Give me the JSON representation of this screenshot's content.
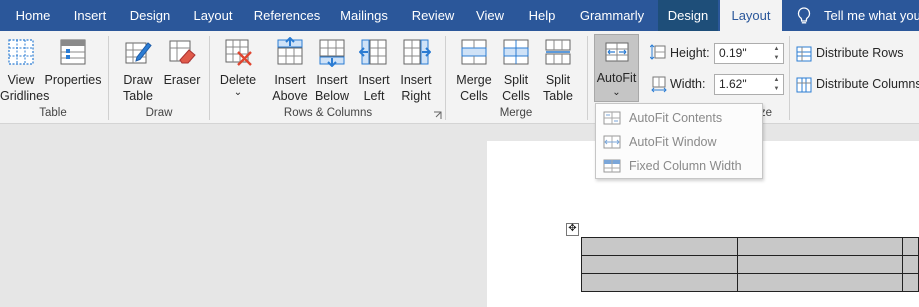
{
  "tabs": [
    {
      "label": "Home"
    },
    {
      "label": "Insert"
    },
    {
      "label": "Design"
    },
    {
      "label": "Layout"
    },
    {
      "label": "References"
    },
    {
      "label": "Mailings"
    },
    {
      "label": "Review"
    },
    {
      "label": "View"
    },
    {
      "label": "Help"
    },
    {
      "label": "Grammarly"
    },
    {
      "label": "Design"
    },
    {
      "label": "Layout"
    }
  ],
  "tell_me": "Tell me what you w",
  "ribbon": {
    "table_group": {
      "label": "Table",
      "view_gridlines": {
        "line1": "View",
        "line2": "Gridlines"
      },
      "properties": "Properties"
    },
    "draw_group": {
      "label": "Draw",
      "draw_table": {
        "line1": "Draw",
        "line2": "Table"
      },
      "eraser": "Eraser"
    },
    "rows_columns_group": {
      "label": "Rows & Columns",
      "delete": "Delete",
      "delete_caret": "⌄",
      "insert_above": {
        "line1": "Insert",
        "line2": "Above"
      },
      "insert_below": {
        "line1": "Insert",
        "line2": "Below"
      },
      "insert_left": {
        "line1": "Insert",
        "line2": "Left"
      },
      "insert_right": {
        "line1": "Insert",
        "line2": "Right"
      }
    },
    "merge_group": {
      "label": "Merge",
      "merge_cells": {
        "line1": "Merge",
        "line2": "Cells"
      },
      "split_cells": {
        "line1": "Split",
        "line2": "Cells"
      },
      "split_table": {
        "line1": "Split",
        "line2": "Table"
      }
    },
    "cell_size_group": {
      "label_visible": "ze",
      "autofit": "AutoFit",
      "autofit_caret": "⌄",
      "height_label": "Height:",
      "height_value": "0.19\"",
      "width_label": "Width:",
      "width_value": "1.62\"",
      "distribute_rows": "Distribute Rows",
      "distribute_columns": "Distribute Columns"
    }
  },
  "autofit_menu": {
    "items": [
      {
        "label": "AutoFit Contents"
      },
      {
        "label": "AutoFit Window"
      },
      {
        "label": "Fixed Column Width"
      }
    ]
  },
  "colors": {
    "tab_bar": "#2b579a",
    "ribbon_bg": "#f3f3f3",
    "workspace_bg": "#e6e6e6",
    "selected_cell": "#c8c8c8",
    "icon_blue": "#2b7cd3"
  }
}
